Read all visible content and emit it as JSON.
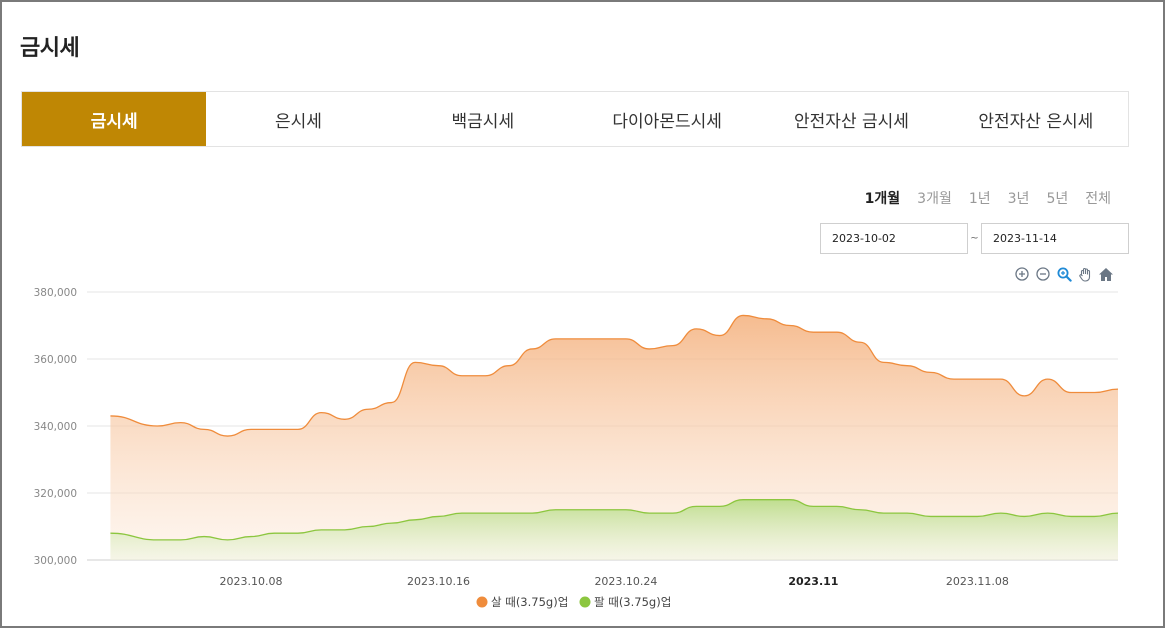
{
  "page": {
    "title": "금시세"
  },
  "tabs": [
    {
      "label": "금시세",
      "active": true
    },
    {
      "label": "은시세",
      "active": false
    },
    {
      "label": "백금시세",
      "active": false
    },
    {
      "label": "다이아몬드시세",
      "active": false
    },
    {
      "label": "안전자산 금시세",
      "active": false
    },
    {
      "label": "안전자산 은시세",
      "active": false
    }
  ],
  "periods": [
    {
      "label": "1개월",
      "active": true
    },
    {
      "label": "3개월",
      "active": false
    },
    {
      "label": "1년",
      "active": false
    },
    {
      "label": "3년",
      "active": false
    },
    {
      "label": "5년",
      "active": false
    },
    {
      "label": "전체",
      "active": false
    }
  ],
  "date_range": {
    "start": "2023-10-02",
    "separator": "~",
    "end": "2023-11-14"
  },
  "toolbar": {
    "icons": [
      "zoom-in-icon",
      "zoom-out-icon",
      "magnify-icon",
      "pan-hand-icon",
      "home-icon"
    ]
  },
  "colors": {
    "accent": "#bf8704",
    "buy": "#ef8c3c",
    "sell": "#8cc63f"
  },
  "chart_data": {
    "type": "area",
    "x": [
      "2023-10-02",
      "2023-10-04",
      "2023-10-05",
      "2023-10-06",
      "2023-10-07",
      "2023-10-08",
      "2023-10-09",
      "2023-10-10",
      "2023-10-11",
      "2023-10-12",
      "2023-10-13",
      "2023-10-14",
      "2023-10-15",
      "2023-10-16",
      "2023-10-17",
      "2023-10-18",
      "2023-10-19",
      "2023-10-20",
      "2023-10-21",
      "2023-10-22",
      "2023-10-23",
      "2023-10-24",
      "2023-10-25",
      "2023-10-26",
      "2023-10-27",
      "2023-10-28",
      "2023-10-29",
      "2023-10-30",
      "2023-10-31",
      "2023-11-01",
      "2023-11-02",
      "2023-11-03",
      "2023-11-04",
      "2023-11-05",
      "2023-11-06",
      "2023-11-07",
      "2023-11-08",
      "2023-11-09",
      "2023-11-10",
      "2023-11-11",
      "2023-11-12",
      "2023-11-13",
      "2023-11-14"
    ],
    "series": [
      {
        "name": "살 때(3.75g)업",
        "color": "#ef8c3c",
        "values": [
          343000,
          340000,
          341000,
          339000,
          337000,
          339000,
          339000,
          339000,
          344000,
          342000,
          345000,
          347000,
          359000,
          358000,
          355000,
          355000,
          358000,
          363000,
          366000,
          366000,
          366000,
          366000,
          363000,
          364000,
          369000,
          367000,
          373000,
          372000,
          370000,
          368000,
          368000,
          365000,
          359000,
          358000,
          356000,
          354000,
          354000,
          354000,
          349000,
          354000,
          350000,
          350000,
          351000
        ]
      },
      {
        "name": "팔 때(3.75g)업",
        "color": "#8cc63f",
        "values": [
          308000,
          306000,
          306000,
          307000,
          306000,
          307000,
          308000,
          308000,
          309000,
          309000,
          310000,
          311000,
          312000,
          313000,
          314000,
          314000,
          314000,
          314000,
          315000,
          315000,
          315000,
          315000,
          314000,
          314000,
          316000,
          316000,
          318000,
          318000,
          318000,
          316000,
          316000,
          315000,
          314000,
          314000,
          313000,
          313000,
          313000,
          314000,
          313000,
          314000,
          313000,
          313000,
          314000
        ]
      }
    ],
    "x_ticks": [
      {
        "date": "2023-10-08",
        "label": "2023.10.08",
        "bold": false
      },
      {
        "date": "2023-10-16",
        "label": "2023.10.16",
        "bold": false
      },
      {
        "date": "2023-10-24",
        "label": "2023.10.24",
        "bold": false
      },
      {
        "date": "2023-11-01",
        "label": "2023.11",
        "bold": true
      },
      {
        "date": "2023-11-08",
        "label": "2023.11.08",
        "bold": false
      }
    ],
    "y_ticks": [
      {
        "value": 380000,
        "label": "380,000"
      },
      {
        "value": 360000,
        "label": "360,000"
      },
      {
        "value": 340000,
        "label": "340,000"
      },
      {
        "value": 320000,
        "label": "320,000"
      },
      {
        "value": 300000,
        "label": "300,000"
      }
    ],
    "ylim": [
      300000,
      380000
    ],
    "xlim": [
      "2023-10-01",
      "2023-11-14"
    ],
    "grid": true,
    "legend_position": "bottom-center",
    "title": "",
    "xlabel": "",
    "ylabel": ""
  }
}
